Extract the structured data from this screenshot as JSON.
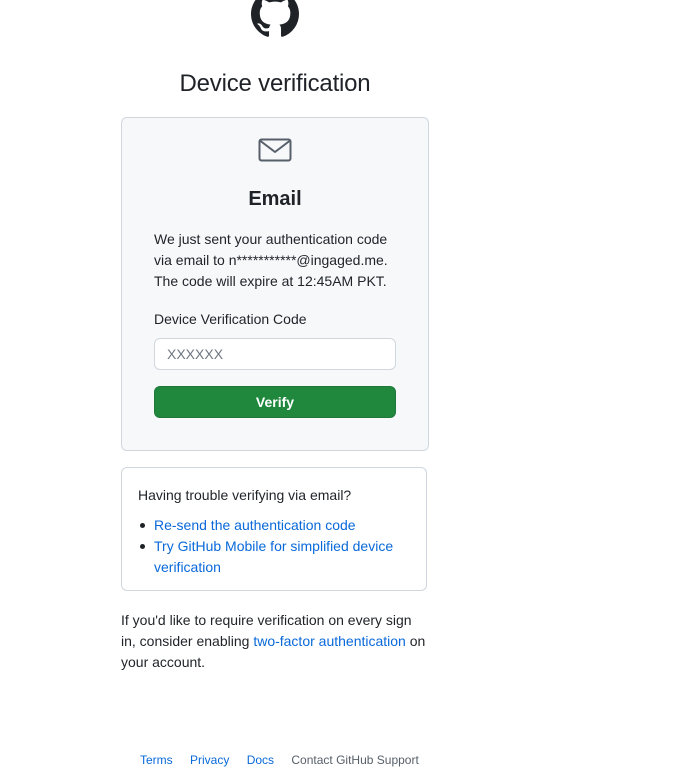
{
  "page": {
    "title": "Device verification"
  },
  "card": {
    "icon": "mail-icon",
    "heading": "Email",
    "message_line1": "We just sent your authentication code",
    "message_line2": "via email to n***********@ingaged.me.",
    "message_line3": "The code will expire at 12:45AM PKT.",
    "field_label": "Device Verification Code",
    "input_placeholder": "XXXXXX",
    "input_value": "",
    "verify_label": "Verify"
  },
  "help": {
    "title": "Having trouble verifying via email?",
    "links": [
      {
        "label": "Re-send the authentication code"
      },
      {
        "label": "Try GitHub Mobile for simplified device verification"
      }
    ]
  },
  "footnote": {
    "before": "If you'd like to require verification on every sign in, consider enabling ",
    "link": "two-factor authentication",
    "after": " on your account."
  },
  "footer": {
    "terms": "Terms",
    "privacy": "Privacy",
    "docs": "Docs",
    "support": "Contact GitHub Support"
  },
  "colors": {
    "accent": "#0969da",
    "button": "#1f883d",
    "card_bg": "#f6f8fa",
    "border": "#d0d7de"
  }
}
